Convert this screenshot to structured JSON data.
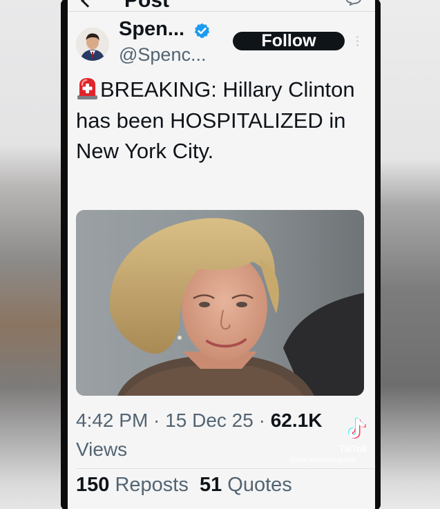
{
  "header": {
    "title": "Post",
    "back_icon": "back-arrow-icon",
    "action_icon": "reply-icon"
  },
  "author": {
    "name": "Spen...",
    "handle": "@Spenc...",
    "verified_icon": "verified-badge-icon",
    "verified_color": "#1d9bf0",
    "follow_label": "Follow",
    "more_icon": "more-options-icon"
  },
  "post": {
    "emoji_icon": "rotating-siren-icon",
    "text": "BREAKING: Hillary Clinton has been HOSPITALIZED in New York City.",
    "image_icon": "portrait-photo"
  },
  "meta": {
    "time": "4:42 PM",
    "separator": " · ",
    "date": "15 Dec 25",
    "views_count": "62.1K",
    "views_label": "Views"
  },
  "stats": {
    "reposts_count": "150",
    "reposts_label": "Reposts",
    "quotes_count": "51",
    "quotes_label": "Quotes"
  },
  "watermark": {
    "logo_icon": "tiktok-logo-icon",
    "brand": "TikTok",
    "username": "@tracynicoleagain4"
  },
  "colors": {
    "text": "#0f1419",
    "secondary": "#536471",
    "follow_bg": "#0f1419",
    "screen_bg": "#f5f5f6"
  }
}
